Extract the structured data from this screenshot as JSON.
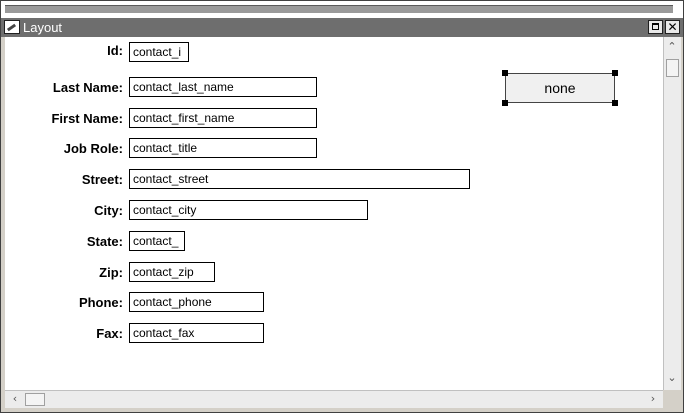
{
  "window": {
    "title": "Layout"
  },
  "fields": [
    {
      "label": "Id:",
      "value": "contact_i"
    },
    {
      "label": "Last Name:",
      "value": "contact_last_name"
    },
    {
      "label": "First Name:",
      "value": "contact_first_name"
    },
    {
      "label": "Job Role:",
      "value": "contact_title"
    },
    {
      "label": "Street:",
      "value": "contact_street"
    },
    {
      "label": "City:",
      "value": "contact_city"
    },
    {
      "label": "State:",
      "value": "contact_"
    },
    {
      "label": "Zip:",
      "value": "contact_zip"
    },
    {
      "label": "Phone:",
      "value": "contact_phone"
    },
    {
      "label": "Fax:",
      "value": "contact_fax"
    }
  ],
  "button": {
    "label": "none"
  },
  "icons": {
    "window": "layout-icon",
    "maximize": "maximize-icon",
    "close": "close-icon",
    "scroll_up": "arrow-up-icon",
    "scroll_down": "arrow-down-icon",
    "scroll_left": "arrow-left-icon",
    "scroll_right": "arrow-right-icon"
  }
}
